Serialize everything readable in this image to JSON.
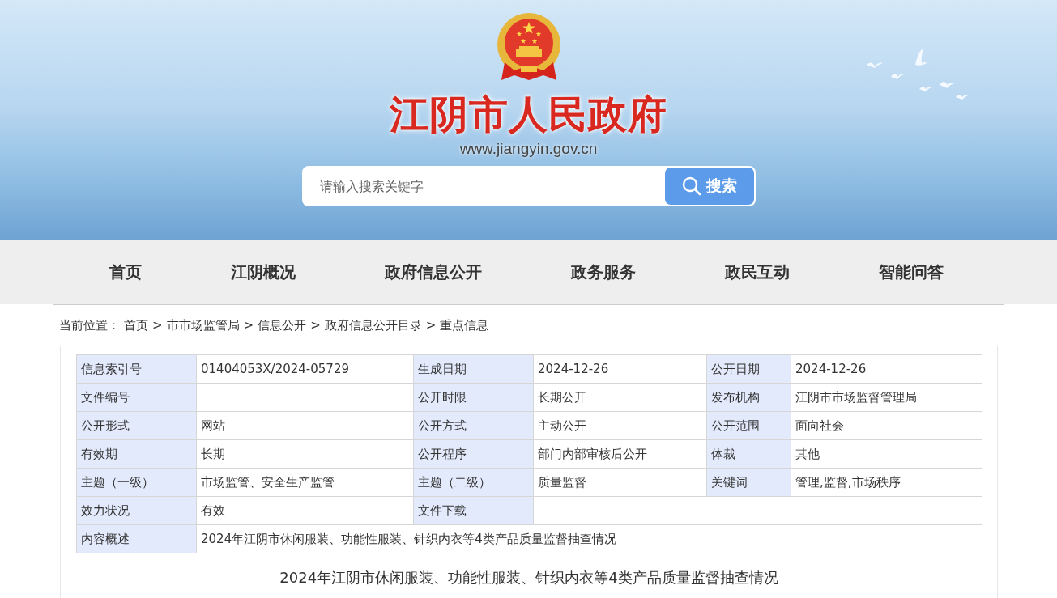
{
  "header": {
    "site_title": "江阴市人民政府",
    "site_url": "www.jiangyin.gov.cn",
    "search": {
      "placeholder": "请输入搜索关键字",
      "button": "搜索"
    }
  },
  "nav": [
    {
      "label": "首页"
    },
    {
      "label": "江阴概况"
    },
    {
      "label": "政府信息公开"
    },
    {
      "label": "政务服务"
    },
    {
      "label": "政民互动"
    },
    {
      "label": "智能问答"
    }
  ],
  "breadcrumb": {
    "prefix": "当前位置：",
    "items": [
      "首页",
      "市市场监管局",
      "信息公开",
      "政府信息公开目录",
      "重点信息"
    ],
    "separator": ">"
  },
  "info_table": {
    "rows": [
      {
        "fields": [
          {
            "label": "信息索引号",
            "value": "01404053X/2024-05729"
          },
          {
            "label": "生成日期",
            "value": "2024-12-26"
          },
          {
            "label": "公开日期",
            "value": "2024-12-26"
          }
        ]
      },
      {
        "fields": [
          {
            "label": "文件编号"
          },
          {
            "label": "公开时限",
            "value": "长期公开"
          },
          {
            "label": "发布机构",
            "value": "江阴市市场监督管理局"
          }
        ]
      },
      {
        "fields": [
          {
            "label": "公开形式",
            "value": "网站"
          },
          {
            "label": "公开方式",
            "value": "主动公开"
          },
          {
            "label": "公开范围",
            "value": "面向社会"
          }
        ]
      },
      {
        "fields": [
          {
            "label": "有效期",
            "value": "长期"
          },
          {
            "label": "公开程序",
            "value": "部门内部审核后公开"
          },
          {
            "label": "体裁",
            "value": "其他"
          }
        ]
      },
      {
        "fields": [
          {
            "label": "主题（一级）",
            "value": "市场监管、安全生产监管"
          },
          {
            "label": "主题（二级）",
            "value": "质量监督"
          },
          {
            "label": "关键词",
            "value": "管理,监督,市场秩序"
          }
        ]
      },
      {
        "fields": [
          {
            "label": "效力状况",
            "value": "有效"
          },
          {
            "label": "文件下载"
          }
        ]
      },
      {
        "fields": [
          {
            "label": "内容概述",
            "value": "2024年江阴市休闲服装、功能性服装、针织内衣等4类产品质量监督抽查情况"
          }
        ]
      }
    ]
  },
  "article": {
    "title": "2024年江阴市休闲服装、功能性服装、针织内衣等4类产品质量监督抽查情况"
  }
}
